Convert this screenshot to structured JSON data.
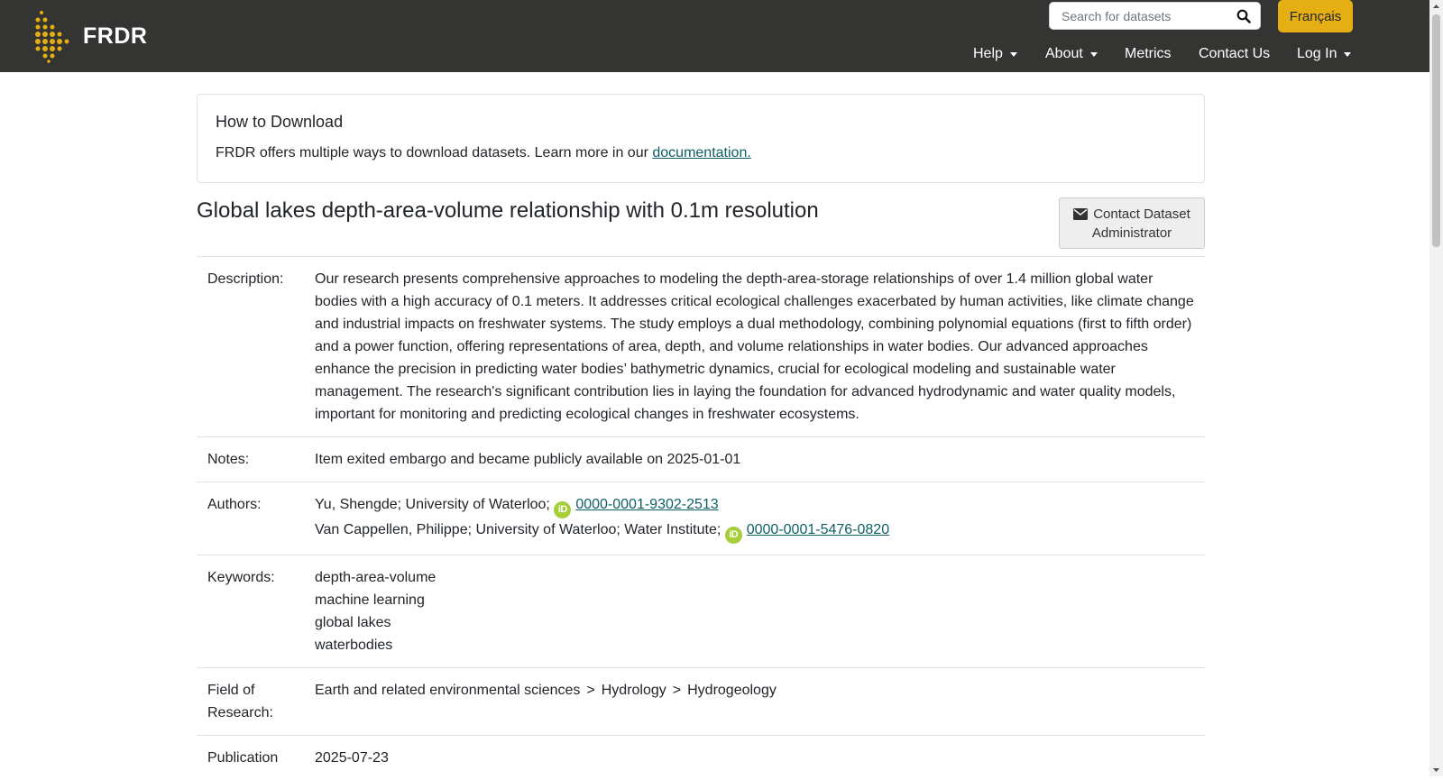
{
  "header": {
    "logo_text": "FRDR",
    "search_placeholder": "Search for datasets",
    "language_button": "Français",
    "nav": [
      {
        "label": "Help",
        "dropdown": true
      },
      {
        "label": "About",
        "dropdown": true
      },
      {
        "label": "Metrics",
        "dropdown": false
      },
      {
        "label": "Contact Us",
        "dropdown": false
      },
      {
        "label": "Log In",
        "dropdown": true
      }
    ],
    "colors": {
      "bar": "#343532",
      "accent": "#e5ae13"
    }
  },
  "download_card": {
    "title": "How to Download",
    "text": "FRDR offers multiple ways to download datasets. Learn more in our ",
    "link": "documentation."
  },
  "dataset": {
    "title": "Global lakes depth-area-volume relationship with 0.1m resolution",
    "contact_button": "Contact Dataset Administrator",
    "description_label": "Description:",
    "description": "Our research presents comprehensive approaches to modeling the depth-area-storage relationships of over 1.4 million global water bodies with a high accuracy of 0.1 meters. It addresses critical ecological challenges exacerbated by human activities, like climate change and industrial impacts on freshwater systems. The study employs a dual methodology, combining polynomial equations (first to fifth order) and a power function, offering representations of area, depth, and volume relationships in water bodies. Our advanced approaches enhance the precision in predicting water bodies’ bathymetric dynamics, crucial for ecological modeling and sustainable water management. The research's significant contribution lies in laying the foundation for advanced hydrodynamic and water quality models, important for monitoring and predicting ecological changes in freshwater ecosystems.",
    "notes_label": "Notes:",
    "notes": "Item exited embargo and became publicly available on 2025-01-01",
    "authors_label": "Authors:",
    "authors": [
      {
        "text": "Yu, Shengde; University of Waterloo;",
        "orcid": "0000-0001-9302-2513"
      },
      {
        "text": "Van Cappellen, Philippe; University of Waterloo; Water Institute;",
        "orcid": "0000-0001-5476-0820"
      }
    ],
    "orcid_badge": "iD",
    "keywords_label": "Keywords:",
    "keywords": [
      "depth-area-volume",
      "machine learning",
      "global lakes",
      "waterbodies"
    ],
    "field_label": "Field of Research:",
    "field": [
      "Earth and related environmental sciences",
      "Hydrology",
      "Hydrogeology"
    ],
    "field_separator": ">",
    "publication_label": "Publication",
    "publication": "2025-07-23"
  }
}
